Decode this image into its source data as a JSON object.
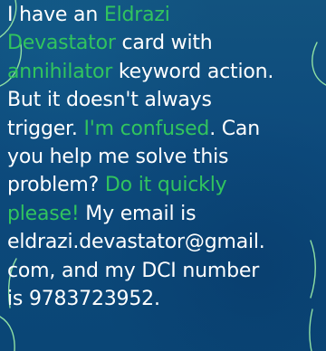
{
  "message": {
    "lines": [
      [
        {
          "text": "I have an ",
          "highlight": false
        },
        {
          "text": "Eldrazi",
          "highlight": true
        }
      ],
      [
        {
          "text": "Devastator",
          "highlight": true
        },
        {
          "text": " card with",
          "highlight": false
        }
      ],
      [
        {
          "text": "annihilator",
          "highlight": true
        },
        {
          "text": " keyword action.",
          "highlight": false
        }
      ],
      [
        {
          "text": "But it doesn't always",
          "highlight": false
        }
      ],
      [
        {
          "text": "trigger. ",
          "highlight": false
        },
        {
          "text": "I'm confused",
          "highlight": true
        },
        {
          "text": ". Can",
          "highlight": false
        }
      ],
      [
        {
          "text": "you help me solve this",
          "highlight": false
        }
      ],
      [
        {
          "text": "problem? ",
          "highlight": false
        },
        {
          "text": "Do it quickly",
          "highlight": true
        }
      ],
      [
        {
          "text": "please!",
          "highlight": true
        },
        {
          "text": " My email is",
          "highlight": false
        }
      ],
      [
        {
          "text": "eldrazi.devastator@gmail.",
          "highlight": false
        }
      ],
      [
        {
          "text": "com, and my DCI number",
          "highlight": false
        }
      ],
      [
        {
          "text": "is 9783723952.",
          "highlight": false
        }
      ]
    ]
  },
  "colors": {
    "background": "#0d4a7c",
    "text": "#ffffff",
    "highlight": "#31c45e",
    "decor": "#8fe0a4"
  }
}
